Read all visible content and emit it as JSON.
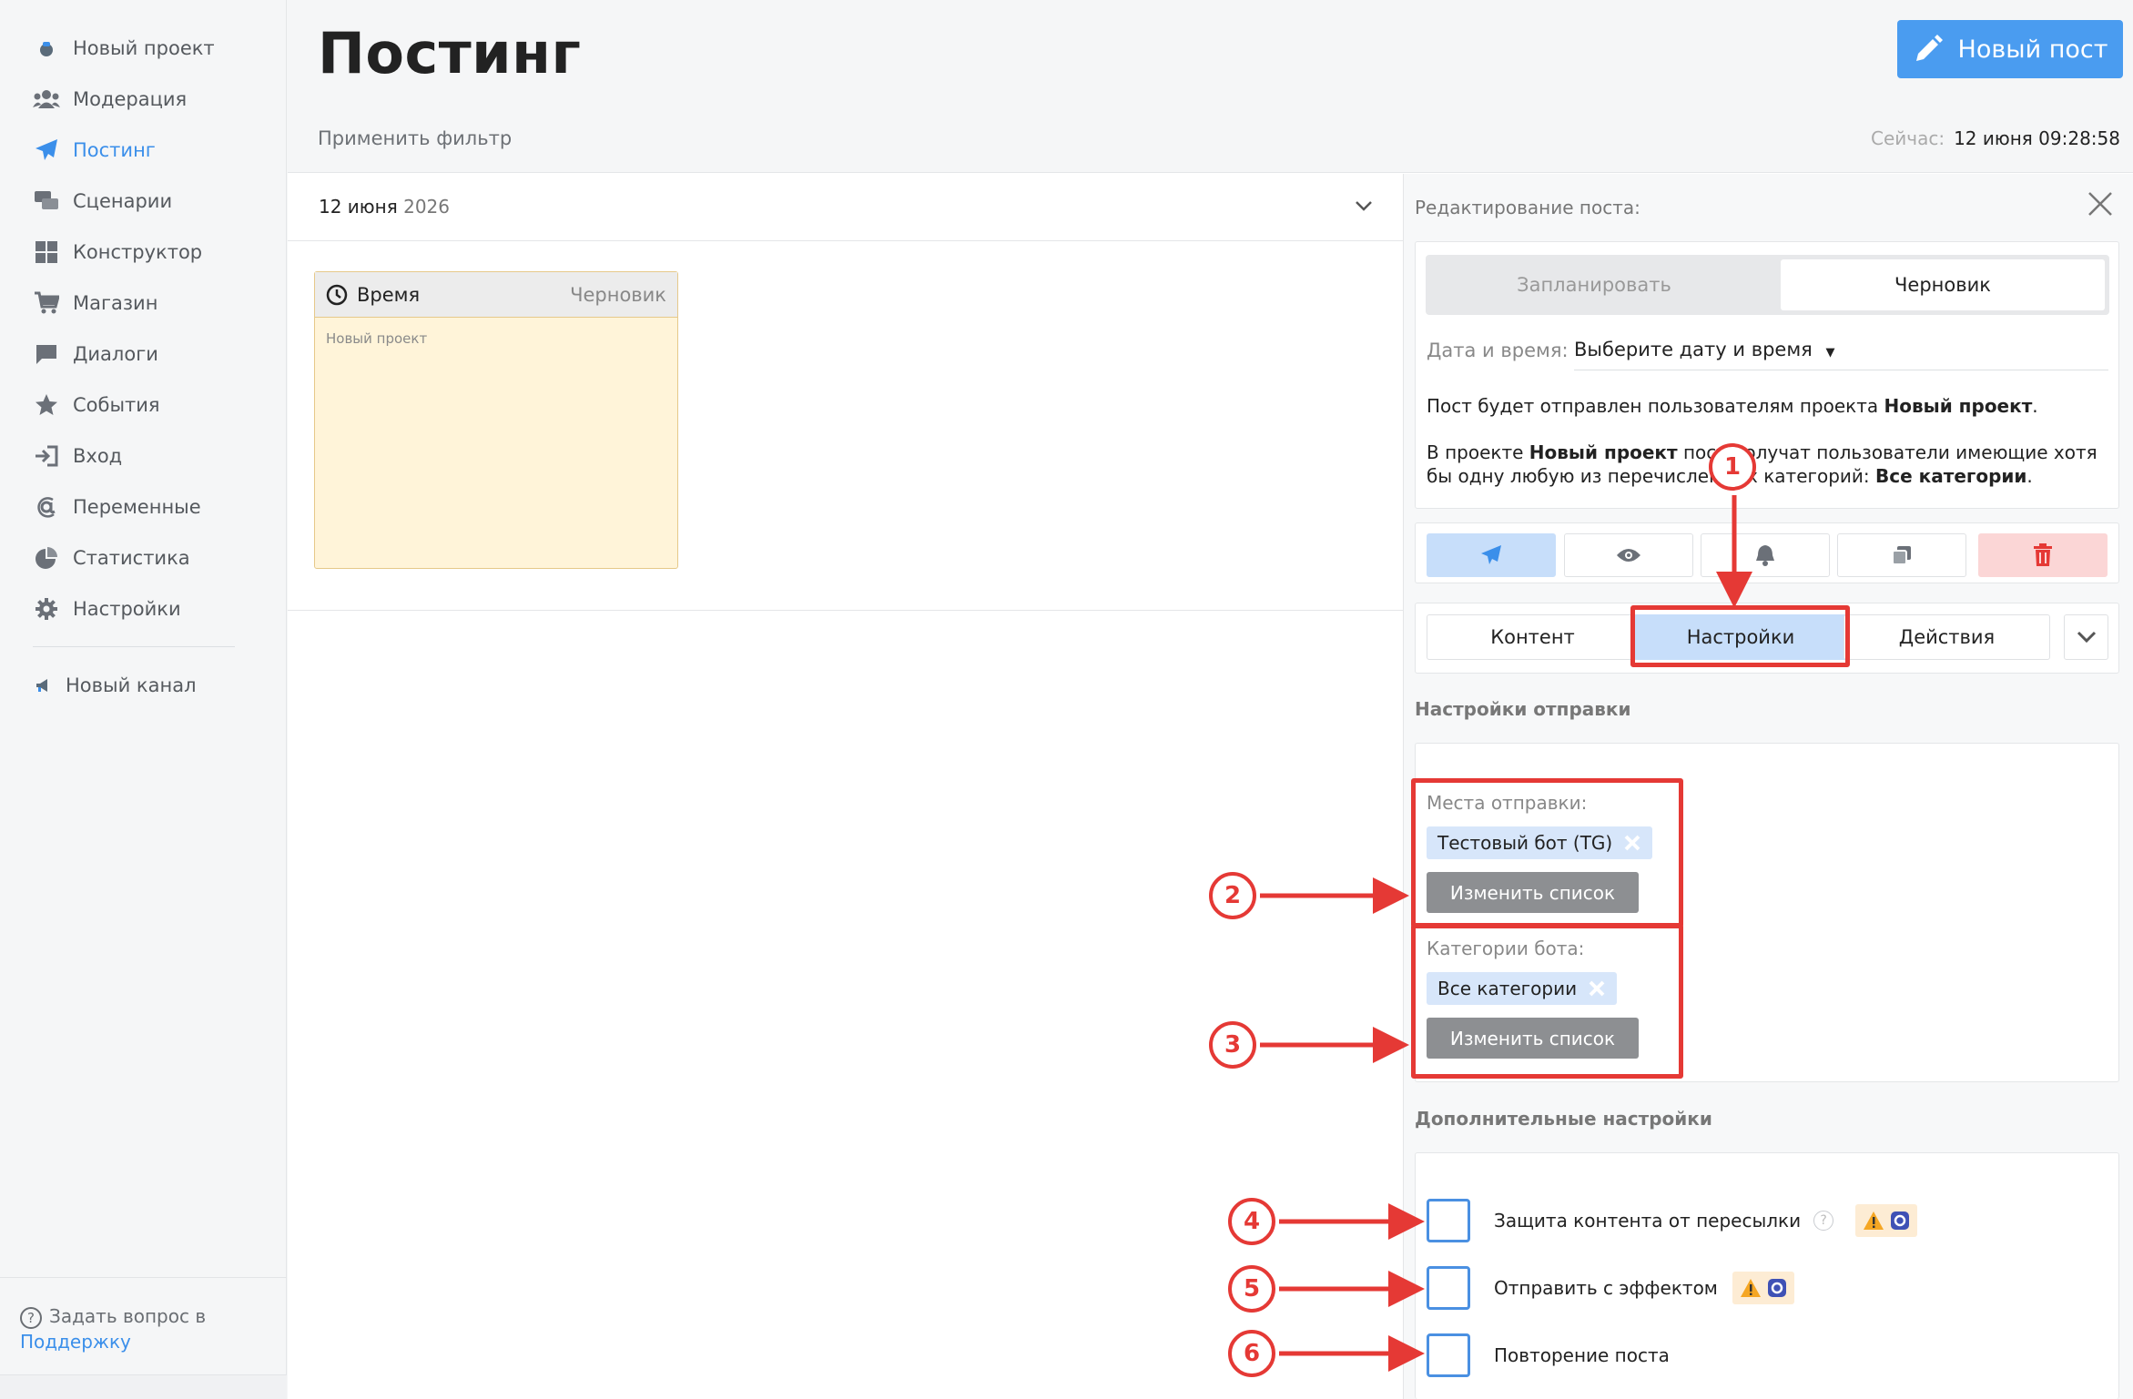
{
  "sidebar": {
    "items": [
      {
        "label": "Новый проект",
        "icon": "project-icon"
      },
      {
        "label": "Модерация",
        "icon": "users-icon"
      },
      {
        "label": "Постинг",
        "icon": "paper-plane-icon",
        "active": true
      },
      {
        "label": "Сценарии",
        "icon": "scenarios-icon"
      },
      {
        "label": "Конструктор",
        "icon": "grid-icon"
      },
      {
        "label": "Магазин",
        "icon": "cart-icon"
      },
      {
        "label": "Диалоги",
        "icon": "chat-icon"
      },
      {
        "label": "События",
        "icon": "star-icon"
      },
      {
        "label": "Вход",
        "icon": "sign-in-icon"
      },
      {
        "label": "Переменные",
        "icon": "variable-icon"
      },
      {
        "label": "Статистика",
        "icon": "pie-chart-icon"
      },
      {
        "label": "Настройки",
        "icon": "gear-icon"
      }
    ],
    "channel": {
      "label": "Новый канал",
      "icon": "megaphone-icon"
    },
    "support_text": "Задать вопрос в",
    "support_link": "Поддержку"
  },
  "header": {
    "title": "Постинг",
    "filter": "Применить фильтр",
    "new_post": "Новый пост",
    "now_label": "Сейчас:",
    "now_value": "12 июня 09:28:58"
  },
  "date_group": {
    "day": "12 июня",
    "year": "2026"
  },
  "post_card": {
    "time_label": "Время",
    "status": "Черновик",
    "project": "Новый проект"
  },
  "panel": {
    "title": "Редактирование поста:",
    "mode_schedule": "Запланировать",
    "mode_draft": "Черновик",
    "datetime_label": "Дата и время:",
    "datetime_value": "Выберите дату и время",
    "info1_a": "Пост будет отправлен пользователям проекта ",
    "info1_b": "Новый проект",
    "info1_c": ".",
    "info2_a": "В проекте ",
    "info2_b": "Новый проект",
    "info2_c": " пост получат пользователи имеющие хотя бы одну любую из перечисленных категорий: ",
    "info2_d": "Все категории",
    "info2_e": ".",
    "tabs": [
      "Контент",
      "Настройки",
      "Действия"
    ],
    "send_settings_title": "Настройки отправки",
    "destinations_label": "Места отправки:",
    "destinations_chip": "Тестовый бот (TG)",
    "change_list": "Изменить список",
    "categories_label": "Категории бота:",
    "categories_chip": "Все категории",
    "extra_title": "Дополнительные настройки",
    "options": [
      "Защита контента от пересылки",
      "Отправить с эффектом",
      "Повторение поста"
    ],
    "help": "?"
  },
  "annotations": [
    "1",
    "2",
    "3",
    "4",
    "5",
    "6"
  ],
  "colors": {
    "accent": "#4a9cf0",
    "annotation": "#e53935",
    "active_tab": "#c7defa",
    "card": "#fff4d9"
  }
}
